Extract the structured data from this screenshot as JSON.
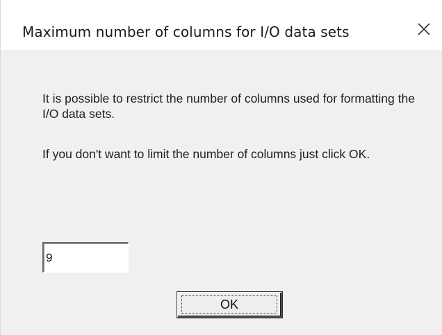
{
  "dialog": {
    "title": "Maximum number of columns for I/O data sets",
    "close_icon": "close-icon"
  },
  "message": {
    "line1": "It is possible to restrict the number of columns used for formatting the I/O data sets.",
    "line2": "If you don't want to limit the number of columns just click OK."
  },
  "columns_input": {
    "value": "9"
  },
  "ok_button": {
    "label": "OK"
  }
}
